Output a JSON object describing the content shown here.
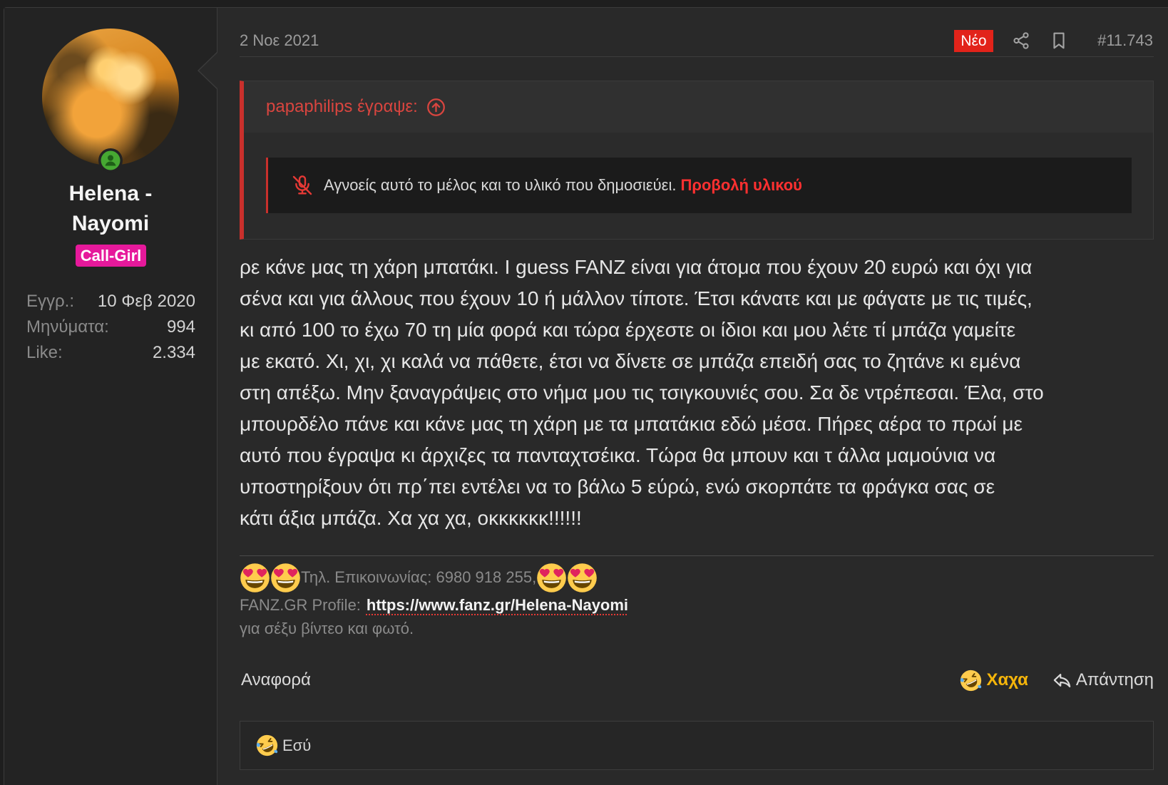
{
  "post": {
    "date": "2 Νοε 2021",
    "new_badge": "Νέο",
    "number": "#11.743"
  },
  "user": {
    "name": "Helena - Nayomi",
    "title_badge": "Call-Girl",
    "stats": [
      {
        "label": "Εγγρ.:",
        "value": "10 Φεβ 2020"
      },
      {
        "label": "Μηνύματα:",
        "value": "994"
      },
      {
        "label": "Like:",
        "value": "2.334"
      }
    ]
  },
  "quote": {
    "author_line": "papaphilips έγραψε:",
    "ignored_text": "Αγνοείς αυτό το μέλος και το υλικό που δημοσιεύει.",
    "show_content_link": "Προβολή υλικού"
  },
  "body": {
    "lines": [
      "ρε κάνε μας τη χάρη μπατάκι. I guess FANZ είναι για άτομα που έχουν 20 ευρώ και όχι για",
      "σένα και για άλλους που έχουν 10 ή μάλλον τίποτε. Έτσι κάνατε και με φάγατε με τις τιμές,",
      "κι από 100 το έχω 70 τη μία φορά και τώρα έρχεστε οι ίδιοι και μου λέτε τί μπάζα γαμείτε",
      "με εκατό. Χι, χι, χι καλά να πάθετε, έτσι να δίνετε σε μπάζα επειδή σας το ζητάνε κι εμένα",
      "στη απέξω. Μην ξαναγράψεις στο νήμα μου τις τσιγκουνιές σου. Σα δε ντρέπεσαι. Έλα, στο",
      "μπουρδέλο πάνε και κάνε μας τη χάρη με τα μπατάκια εδώ μέσα. Πήρες αέρα το πρωί με",
      "αυτό που έγραψα κι άρχιζες τα πανταχτσέικα. Τώρα θα μπουν και τ άλλα μαμούνια να",
      "υποστηρίξουν ότι πρ΄πει εντέλει να το βάλω 5 εύρώ, ενώ σκορπάτε τα φράγκα σας σε",
      "κάτι άξια μπάζα. Χα χα χα, οκκκκκκ!!!!!!"
    ]
  },
  "signature": {
    "phone_line": "Τηλ. Επικοινωνίας: 6980 918 255,",
    "profile_label": "FANZ.GR Profile:",
    "profile_url": "https://www.fanz.gr/Helena-Nayomi",
    "tagline": "για σέξυ βίντεο και φωτό."
  },
  "actions": {
    "report": "Αναφορά",
    "reaction": "Χαχα",
    "reply": "Απάντηση"
  },
  "reactions_bar": {
    "who": "Εσύ"
  },
  "icons": {
    "online": "online-status-icon",
    "share": "share-icon",
    "bookmark": "bookmark-icon",
    "quote_jump": "circle-arrow-up-icon",
    "ignored": "mute-slash-icon",
    "signature_emoji": "heart-eyes-emoji-icon",
    "reaction_emoji": "laughing-emoji-icon",
    "reply": "reply-icon"
  },
  "colors": {
    "accent_red": "#c9302c",
    "new_badge": "#e2231a",
    "user_badge": "#e6199b",
    "reaction_text": "#f5b50a",
    "online_green": "#46a832",
    "background": "#292929",
    "sidebar": "#232323"
  }
}
